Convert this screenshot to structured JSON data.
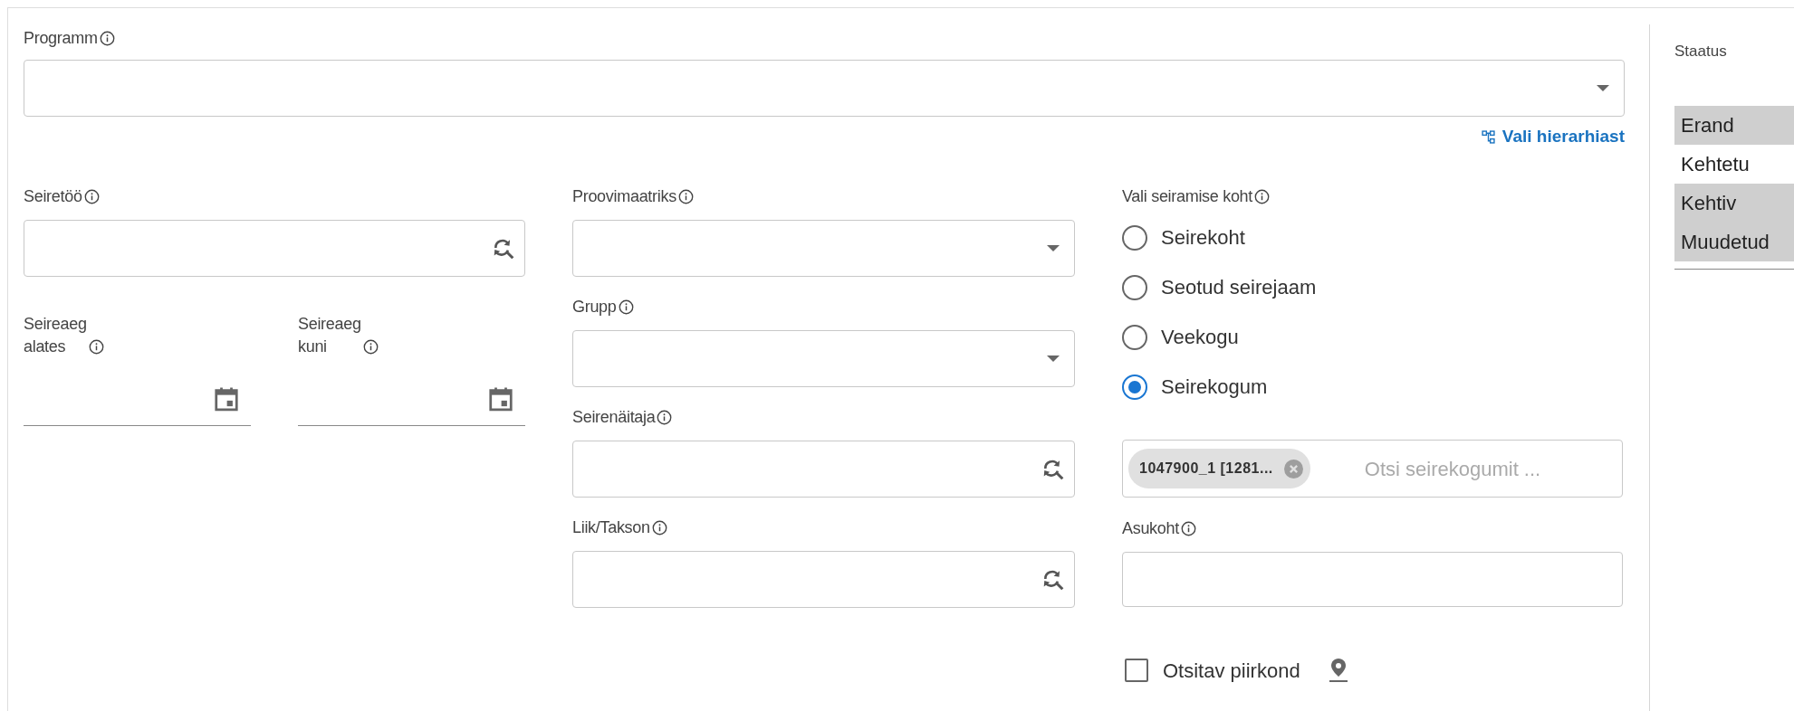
{
  "program": {
    "label": "Programm"
  },
  "hierarchy_link": {
    "label": "Vali hierarhiast"
  },
  "column_1": [
    {
      "kind": "lookup",
      "label": "Seiretöö"
    },
    {
      "kind": "date_pair",
      "fields": [
        {
          "label": "Seireaeg alates"
        },
        {
          "label": "Seireaeg kuni"
        }
      ]
    }
  ],
  "column_2": [
    {
      "kind": "select",
      "label": "Proovimaatriks"
    },
    {
      "kind": "select",
      "label": "Grupp"
    },
    {
      "kind": "lookup",
      "label": "Seirenäitaja"
    },
    {
      "kind": "lookup",
      "label": "Liik/Takson"
    }
  ],
  "site_choice": {
    "label": "Vali seiramise koht",
    "options": [
      {
        "label": "Seirekoht",
        "selected": false
      },
      {
        "label": "Seotud seirejaam",
        "selected": false
      },
      {
        "label": "Veekogu",
        "selected": false
      },
      {
        "label": "Seirekogum",
        "selected": true
      }
    ],
    "chips": [
      {
        "label": "1047900_1 [1281..."
      }
    ],
    "placeholder": "Otsi seirekogumit ..."
  },
  "location": {
    "label": "Asukoht"
  },
  "area_filter": {
    "label": "Otsitav piirkond",
    "checked": false
  },
  "status": {
    "label": "Staatus",
    "items": [
      {
        "label": "Erand",
        "selected": true
      },
      {
        "label": "Kehtetu",
        "selected": false
      },
      {
        "label": "Kehtiv",
        "selected": true
      },
      {
        "label": "Muudetud",
        "selected": true
      }
    ]
  }
}
